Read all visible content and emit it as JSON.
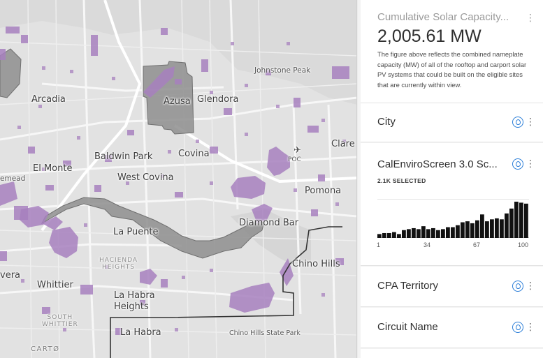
{
  "map": {
    "labels": {
      "johnstone_peak": "Johnstone Peak",
      "arcadia": "Arcadia",
      "glendora": "Glendora",
      "azusa": "Azusa",
      "baldwin_park": "Baldwin Park",
      "covina": "Covina",
      "el_monte": "El Monte",
      "west_covina": "West Covina",
      "emead": "emead",
      "pomona": "Pomona",
      "poc": "POC",
      "clare": "Clare",
      "diamond_bar": "Diamond Bar",
      "la_puente": "La Puente",
      "hacienda_heights": "HACIENDA\nHEIGHTS",
      "chino_hills": "Chino Hills",
      "whittier": "Whittier",
      "vera": "vera",
      "la_habra_heights": "La Habra\nHeights",
      "south_whittier": "SOUTH\nWHITTIER",
      "la_habra": "La Habra",
      "chino_hills_sp": "Chino Hills State Park",
      "carto": "CARTØ"
    }
  },
  "panel": {
    "solar": {
      "title": "Cumulative Solar Capacity...",
      "value": "2,005.61 MW",
      "description": "The figure above reflects the combined nameplate capacity (MW) of all of the rooftop and carport solar PV systems that could be built on the eligible sites that are currently within view."
    },
    "city": {
      "title": "City"
    },
    "calenviro": {
      "title": "CalEnviroScreen 3.0 Sc...",
      "selected": "2.1K SELECTED"
    },
    "cpa": {
      "title": "CPA Territory"
    },
    "circuit": {
      "title": "Circuit Name"
    }
  },
  "chart_data": {
    "type": "bar",
    "title": "CalEnviroScreen 3.0 Sc...",
    "x_ticks": [
      "1",
      "34",
      "67",
      "100"
    ],
    "xlim": [
      1,
      100
    ],
    "values": [
      4,
      5,
      5,
      6,
      4,
      8,
      9,
      10,
      9,
      12,
      9,
      10,
      8,
      9,
      11,
      11,
      13,
      16,
      17,
      15,
      18,
      24,
      17,
      19,
      20,
      19,
      25,
      30,
      37,
      36,
      35
    ]
  },
  "colors": {
    "accent": "#2b7ed8",
    "map_overlay": "#a780be",
    "territory": "#8e8e8e",
    "bars": "#111111"
  },
  "icons": {
    "kebab": "⋮",
    "drop": "drop-icon",
    "airport": "✈"
  }
}
